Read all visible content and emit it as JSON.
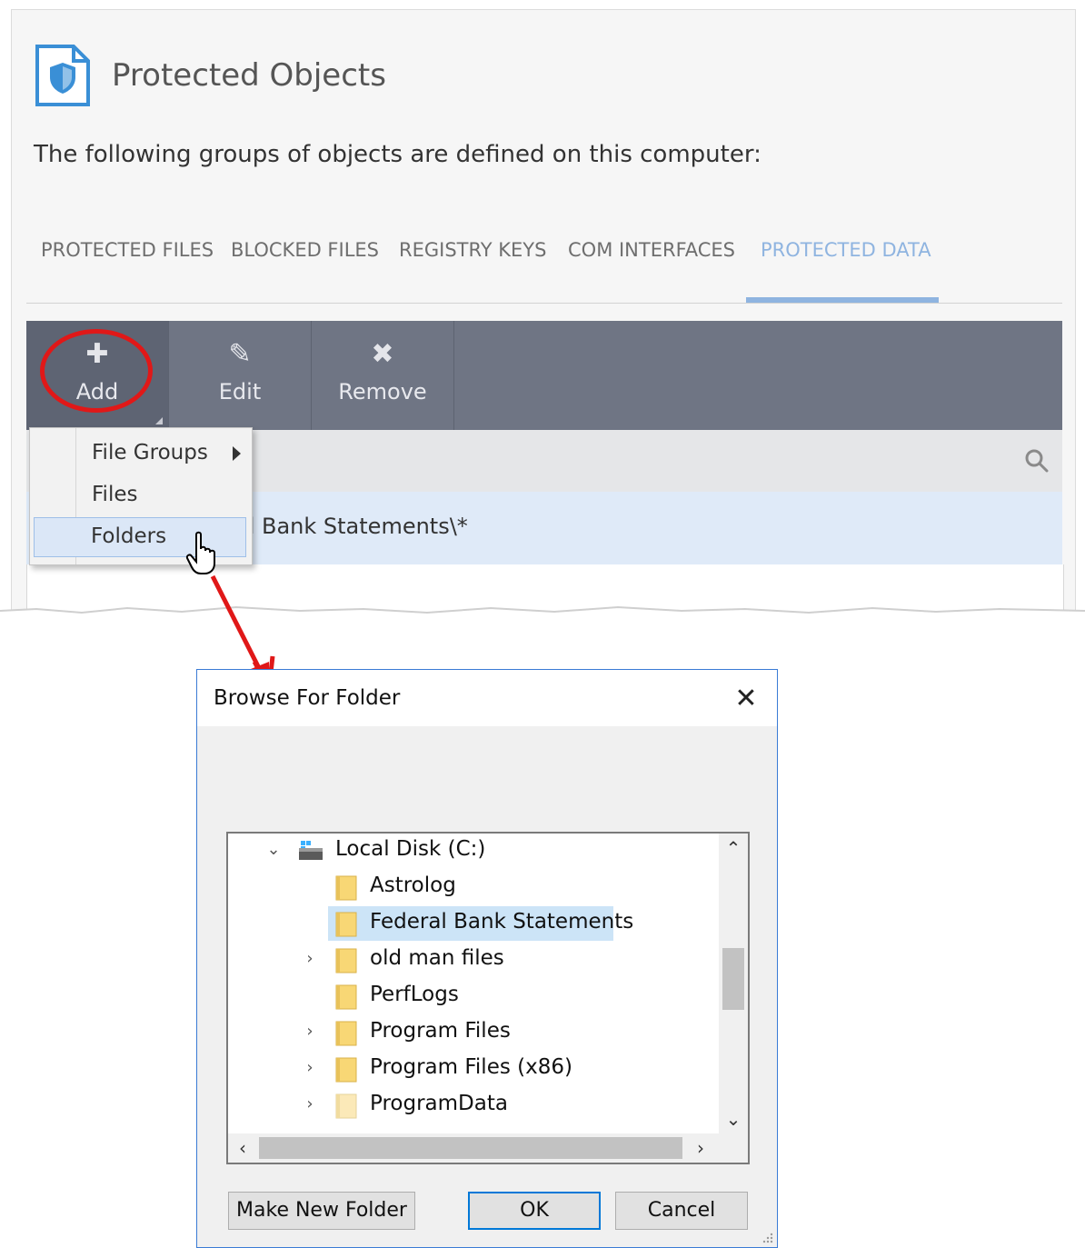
{
  "header": {
    "title": "Protected Objects",
    "subtitle": "The following groups of objects are defined on this computer:"
  },
  "tabs": [
    {
      "label": "PROTECTED FILES"
    },
    {
      "label": "BLOCKED FILES"
    },
    {
      "label": "REGISTRY KEYS"
    },
    {
      "label": "COM INTERFACES"
    },
    {
      "label": "PROTECTED DATA"
    }
  ],
  "toolbar": {
    "add_label": "Add",
    "edit_label": "Edit",
    "remove_label": "Remove"
  },
  "context_menu": {
    "items": [
      {
        "label": "File Groups"
      },
      {
        "label": "Files"
      },
      {
        "label": "Folders"
      }
    ]
  },
  "table": {
    "row_text": "al Bank Statements\\*"
  },
  "dialog": {
    "title": "Browse For Folder",
    "close_glyph": "✕",
    "tree": [
      {
        "label": "Local Disk (C:)"
      },
      {
        "label": "Astrolog"
      },
      {
        "label": "Federal Bank Statements"
      },
      {
        "label": "old man files"
      },
      {
        "label": "PerfLogs"
      },
      {
        "label": "Program Files"
      },
      {
        "label": "Program Files (x86)"
      },
      {
        "label": "ProgramData"
      }
    ],
    "buttons": {
      "make_new_folder": "Make New Folder",
      "ok": "OK",
      "cancel": "Cancel"
    }
  },
  "colors": {
    "accent": "#8fb4e0",
    "toolbar": "#6f7584",
    "annotation": "#e01818",
    "selection": "#cce4f7",
    "folder": "#f8d775"
  },
  "icons": {
    "page": "shield-document-icon",
    "add": "plus-icon",
    "edit": "pencil-icon",
    "remove": "x-icon",
    "search": "search-icon",
    "drive": "drive-icon",
    "folder": "folder-icon"
  }
}
